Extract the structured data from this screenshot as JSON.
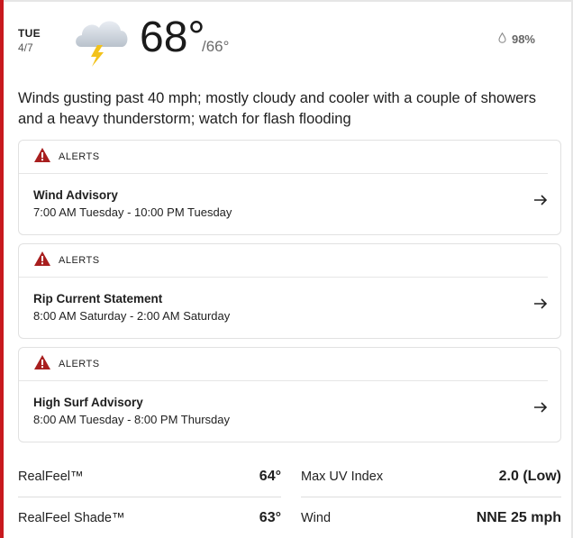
{
  "header": {
    "day": "TUE",
    "date": "4/7",
    "icon": "thunderstorm-cloud-icon",
    "temp_high": "68°",
    "temp_low": "/66°",
    "precip_probability": "98%"
  },
  "summary": "Winds gusting past 40 mph; mostly cloudy and cooler with a couple of showers and a heavy thunderstorm; watch for flash flooding",
  "alerts": [
    {
      "label": "ALERTS",
      "title": "Wind Advisory",
      "time": "7:00 AM Tuesday - 10:00 PM Tuesday"
    },
    {
      "label": "ALERTS",
      "title": "Rip Current Statement",
      "time": "8:00 AM Saturday - 2:00 AM Saturday"
    },
    {
      "label": "ALERTS",
      "title": "High Surf Advisory",
      "time": "8:00 AM Tuesday - 8:00 PM Thursday"
    }
  ],
  "details": {
    "realfeel": {
      "label": "RealFeel™",
      "value": "64°"
    },
    "max_uv": {
      "label": "Max UV Index",
      "value": "2.0 (Low)"
    },
    "realfeel_shade": {
      "label": "RealFeel Shade™",
      "value": "63°"
    },
    "wind": {
      "label": "Wind",
      "value": "NNE 25 mph"
    }
  },
  "colors": {
    "accent": "#c8191e",
    "alert_icon": "#a81e1e",
    "lightning": "#f2c21b"
  }
}
